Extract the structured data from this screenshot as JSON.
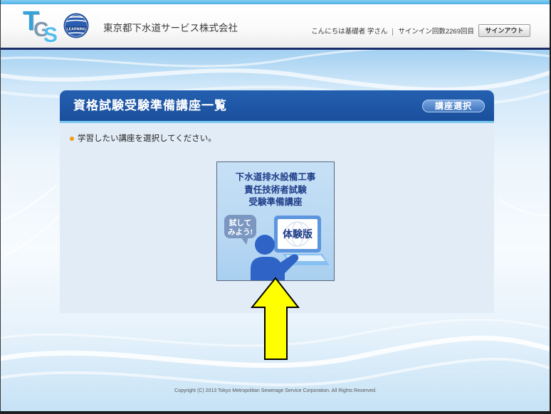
{
  "header": {
    "logo": {
      "letters": [
        "T",
        "G",
        "S"
      ],
      "globe_label": "LEARNING"
    },
    "company_name": "東京都下水道サービス株式会社",
    "greeting": "こんにちは基礎者 学さん",
    "signin_count": "サインイン回数2269回目",
    "signout_label": "サインアウト"
  },
  "panel": {
    "title": "資格試験受験準備講座一覧",
    "badge": "講座選択",
    "instruction": "学習したい講座を選択してください。",
    "course": {
      "title_lines": [
        "下水道排水設備工事",
        "責任技術者試験",
        "受験準備講座"
      ],
      "bubble_lines": [
        "試して",
        "みよう!"
      ],
      "screen_label": "体験版"
    }
  },
  "footer": {
    "copyright": "Copyright (C) 2013 Tokyo Metropolitan Sewerage Service Corporation. All Rights Reserved."
  },
  "colors": {
    "panel_header": "#1d56a5",
    "header_rule": "#1b2c6a",
    "bullet": "#f29b14",
    "arrow_fill": "#ffff00",
    "course_text": "#1e3c88"
  },
  "icons": {
    "logo": "learning-globe-icon",
    "bullet": "bullet-dot-icon",
    "speech_bubble": "speech-bubble-icon",
    "monitor": "monitor-icon",
    "person": "person-icon",
    "arrow": "up-arrow-icon"
  }
}
